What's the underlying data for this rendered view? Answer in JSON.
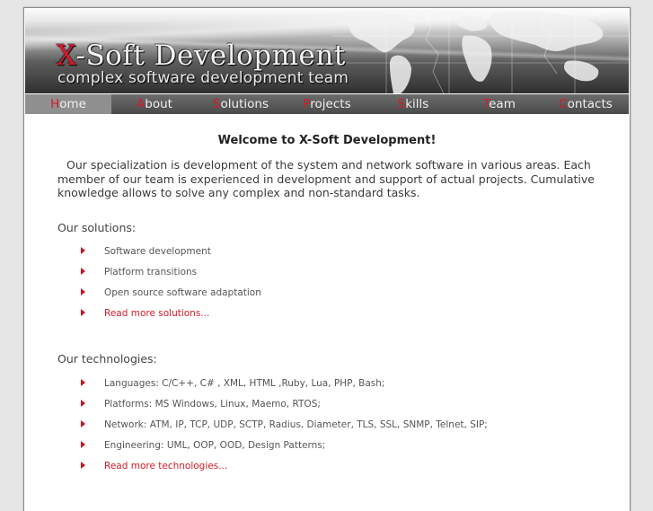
{
  "header": {
    "title_first": "X",
    "title_rest": "-Soft Development",
    "tagline": "complex software development team"
  },
  "nav": {
    "items": [
      {
        "first": "H",
        "rest": "ome"
      },
      {
        "first": "A",
        "rest": "bout"
      },
      {
        "first": "S",
        "rest": "olutions"
      },
      {
        "first": "P",
        "rest": "rojects"
      },
      {
        "first": "S",
        "rest": "kills"
      },
      {
        "first": "T",
        "rest": "eam"
      },
      {
        "first": "C",
        "rest": "ontacts"
      }
    ]
  },
  "content": {
    "welcome": "Welcome to X-Soft Development!",
    "intro": "Our specialization is development of the system and network software in various areas. Each member of our team is experienced in development and support of actual projects. Cumulative knowledge allows to solve any complex and non-standard tasks.",
    "solutions": {
      "heading": "Our solutions:",
      "items": [
        "Software development",
        "Platform transitions",
        "Open source software adaptation"
      ],
      "more": "Read more solutions..."
    },
    "technologies": {
      "heading": "Our technologies:",
      "items": [
        "Languages: C/C++, C# , XML, HTML ,Ruby, Lua, PHP, Bash;",
        "Platforms: MS Windows, Linux, Maemo, RTOS;",
        "Network: ATM, IP, TCP, UDP, SCTP, Radius, Diameter, TLS, SSL, SNMP, Telnet, SIP;",
        "Engineering: UML, OOP, OOD, Design Patterns;"
      ],
      "more": "Read more technologies..."
    }
  },
  "colors": {
    "accent": "#d51a2b",
    "nav_active": "#8f8f8f",
    "nav_bg": "#5a5a5a"
  }
}
